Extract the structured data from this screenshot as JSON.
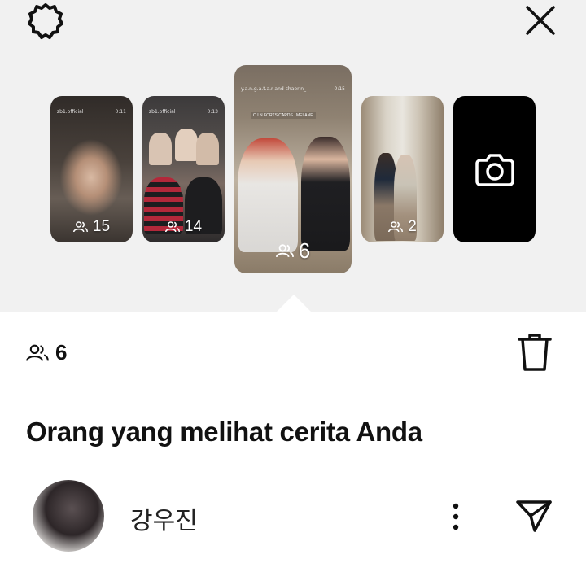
{
  "story_thumbnails": [
    {
      "count": "15",
      "top_left": "zb1.official",
      "top_right": "0:11"
    },
    {
      "count": "14",
      "top_left": "zb1.official",
      "top_right": "0:13"
    },
    {
      "count": "6",
      "top_left": "y.a.n.g.a.t.a.r and chaerin_",
      "top_right": "0:15",
      "caption": "O.I.N FORTS CARDS...MELANE"
    },
    {
      "count": "2",
      "top_left": "",
      "top_right": ""
    }
  ],
  "selected_story": {
    "viewer_count": "6"
  },
  "section_title": "Orang yang melihat cerita Anda",
  "viewers": [
    {
      "name": "강우진"
    }
  ],
  "icons": {
    "settings": "gear-icon",
    "close": "close-icon",
    "viewers": "people-icon",
    "camera": "camera-icon",
    "delete": "trash-icon",
    "more": "more-vertical-icon",
    "send": "send-icon"
  },
  "colors": {
    "top_background": "#f1f1f1",
    "text": "#111111",
    "divider": "#dcdcdc"
  }
}
